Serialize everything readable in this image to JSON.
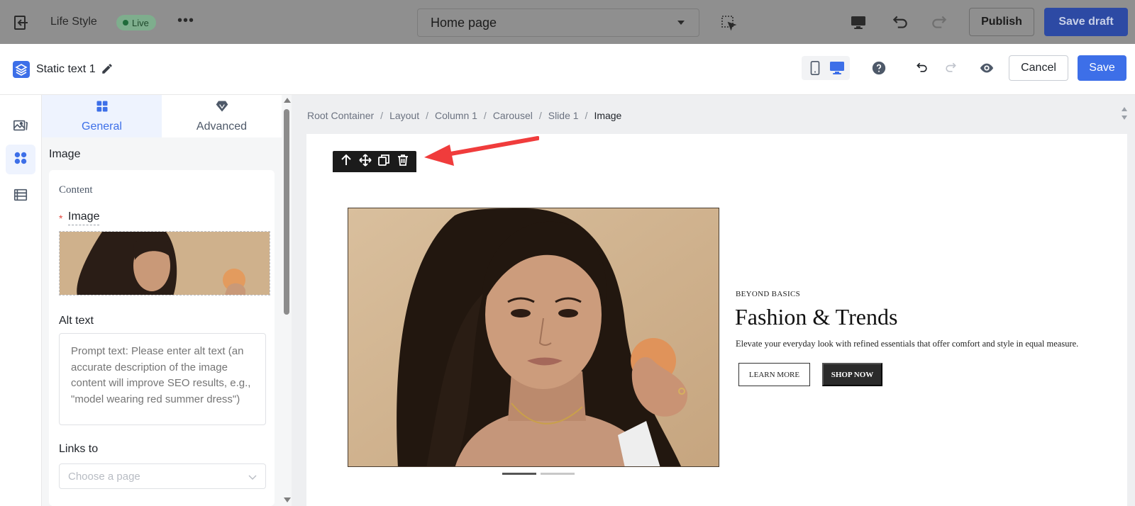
{
  "topbar": {
    "site_name": "Life Style",
    "status_badge": "Live",
    "page_selector": "Home page",
    "publish_label": "Publish",
    "save_draft_label": "Save draft"
  },
  "editor": {
    "component_title": "Static text 1",
    "cancel_label": "Cancel",
    "save_label": "Save"
  },
  "panel": {
    "tabs": [
      {
        "label": "General",
        "active": true
      },
      {
        "label": "Advanced",
        "active": false
      }
    ],
    "section_title": "Image",
    "card": {
      "content_label": "Content",
      "required_marker": "*",
      "image_label": "Image",
      "alt_label": "Alt text",
      "alt_placeholder": "Prompt text: Please enter alt text (an accurate description of the image content will improve SEO results, e.g., \"model wearing red summer dress\")",
      "links_label": "Links to",
      "links_placeholder": "Choose a page"
    }
  },
  "canvas": {
    "breadcrumb": [
      "Root Container",
      "Layout",
      "Column 1",
      "Carousel",
      "Slide 1",
      "Image"
    ],
    "hero": {
      "kicker": "BEYOND BASICS",
      "headline": "Fashion & Trends",
      "subtext": "Elevate your everyday look with refined essentials that offer comfort and style in equal measure.",
      "learn_more": "LEARN MORE",
      "shop_now": "SHOP NOW"
    },
    "carousel_slide_count": 2,
    "active_slide": 1
  },
  "colors": {
    "accent": "#3d6fe8",
    "live_green": "#1f6b3a",
    "annotation_red": "#f03c3c"
  }
}
